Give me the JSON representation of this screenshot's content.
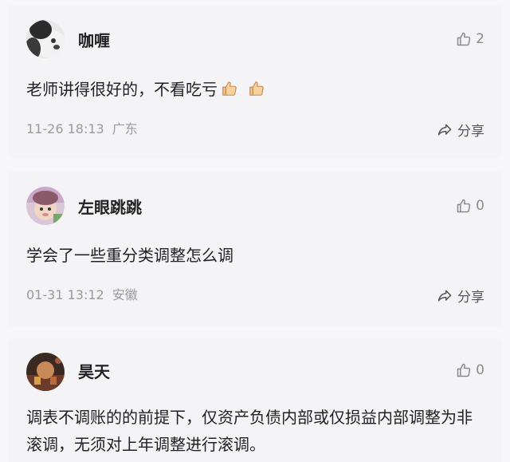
{
  "comments": [
    {
      "username": "咖喱",
      "likes": "2",
      "text": "老师讲得很好的，不看吃亏",
      "emoji": [
        "thumbs-up-emoji",
        "thumbs-up-emoji"
      ],
      "date": "11-26 18:13",
      "location": "广东",
      "share_label": "分享"
    },
    {
      "username": "左眼跳跳",
      "likes": "0",
      "text": "学会了一些重分类调整怎么调",
      "date": "01-31 13:12",
      "location": "安徽",
      "share_label": "分享"
    },
    {
      "username": "昊天",
      "likes": "0",
      "text": "调表不调账的的前提下，仅资产负债内部或仅损益内部调整为非滚调，无须对上年调整进行滚调。"
    }
  ],
  "colors": {
    "page_bg": "#f7f7f9",
    "card_bg": "#f4f4f6",
    "text": "#222222",
    "muted": "#999aa0"
  }
}
